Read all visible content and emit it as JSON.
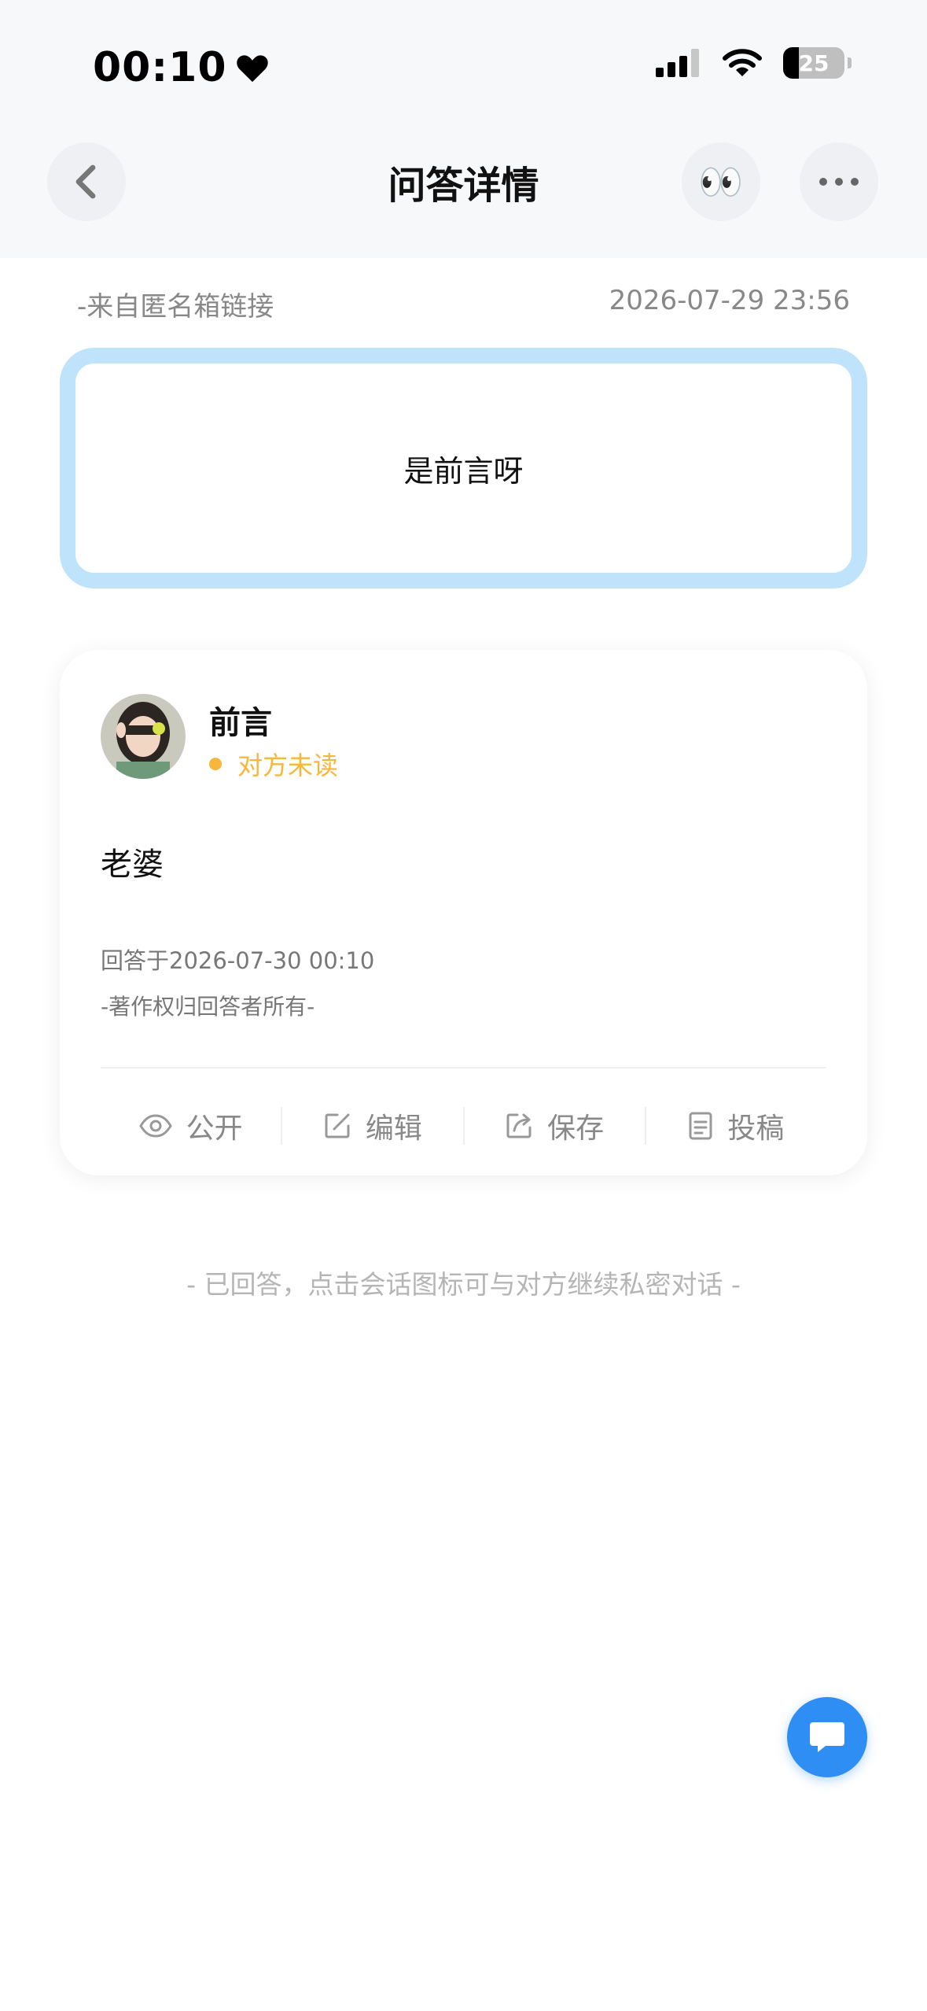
{
  "status_bar": {
    "time": "00:10",
    "battery": "25"
  },
  "nav": {
    "title": "问答详情",
    "eyes_emoji": "👀"
  },
  "question": {
    "source": "-来自匿名箱链接",
    "timestamp": "2026-07-29 23:56",
    "text": "是前言呀"
  },
  "answer": {
    "author": "前言",
    "read_status": "对方未读",
    "text": "老婆",
    "answered_at": "回答于2026-07-30 00:10",
    "copyright": "-著作权归回答者所有-",
    "actions": {
      "public": "公开",
      "edit": "编辑",
      "save": "保存",
      "submit": "投稿"
    }
  },
  "footer_hint": "- 已回答，点击会话图标可与对方继续私密对话 -",
  "colors": {
    "accent_blue": "#2f8ef4",
    "question_border": "#bfe3fb",
    "unread_orange": "#f6b73c"
  }
}
